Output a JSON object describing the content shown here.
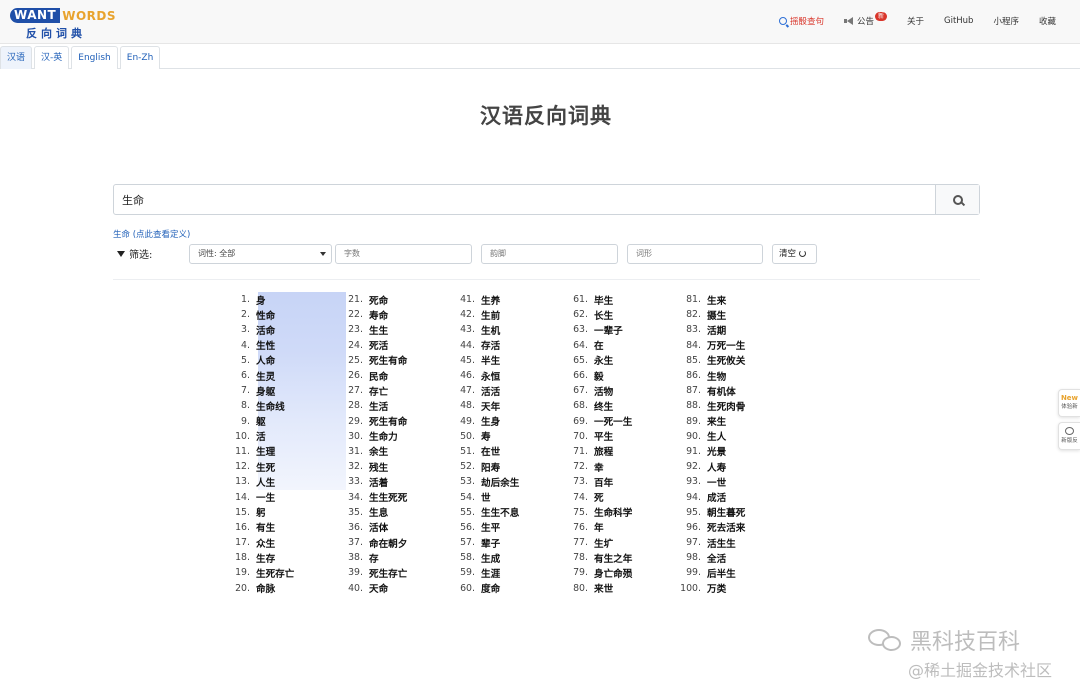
{
  "logo": {
    "want": "WANT",
    "words": "WORDS",
    "cn": "反向词典"
  },
  "nav": {
    "random": "摇骰查句",
    "notice": "公告",
    "notice_badge": "新",
    "about": "关于",
    "github": "GitHub",
    "miniapp": "小程序",
    "favorite": "收藏"
  },
  "tabs": [
    {
      "label": "汉语",
      "active": true
    },
    {
      "label": "汉-英",
      "active": false
    },
    {
      "label": "English",
      "active": false
    },
    {
      "label": "En-Zh",
      "active": false
    }
  ],
  "title": "汉语反向词典",
  "search": {
    "value": "生命"
  },
  "definition_link": "生命 (点此查看定义)",
  "filter": {
    "label": "筛选:",
    "pos_selected": "词性: 全部",
    "chars_placeholder": "字数",
    "rhyme_placeholder": "韵脚",
    "shape_placeholder": "词形",
    "clear": "清空"
  },
  "results": [
    "身",
    "性命",
    "活命",
    "生性",
    "人命",
    "生灵",
    "身躯",
    "生命线",
    "躯",
    "活",
    "生理",
    "生死",
    "人生",
    "一生",
    "躬",
    "有生",
    "众生",
    "生存",
    "生死存亡",
    "命脉",
    "死命",
    "寿命",
    "生生",
    "死活",
    "死生有命",
    "民命",
    "存亡",
    "生活",
    "死生有命",
    "生命力",
    "余生",
    "残生",
    "活着",
    "生生死死",
    "生息",
    "活体",
    "命在朝夕",
    "存",
    "死生存亡",
    "天命",
    "生养",
    "生前",
    "生机",
    "存活",
    "半生",
    "永恒",
    "活活",
    "天年",
    "生身",
    "寿",
    "在世",
    "阳寿",
    "劫后余生",
    "世",
    "生生不息",
    "生平",
    "辈子",
    "生成",
    "生涯",
    "度命",
    "毕生",
    "长生",
    "一辈子",
    "在",
    "永生",
    "毅",
    "活物",
    "终生",
    "一死一生",
    "平生",
    "旅程",
    "幸",
    "百年",
    "死",
    "生命科学",
    "年",
    "生圹",
    "有生之年",
    "身亡命殒",
    "来世",
    "生来",
    "摄生",
    "活期",
    "万死一生",
    "生死攸关",
    "生物",
    "有机体",
    "生死肉骨",
    "来生",
    "生人",
    "光景",
    "人寿",
    "一世",
    "成活",
    "朝生暮死",
    "死去活来",
    "活生生",
    "全活",
    "后半生",
    "万类"
  ],
  "float_widgets": [
    {
      "top": "New",
      "label": "体验新"
    },
    {
      "label": "新版反"
    }
  ],
  "watermark": {
    "line1": "黑科技百科",
    "line2": "@稀土掘金技术社区"
  }
}
